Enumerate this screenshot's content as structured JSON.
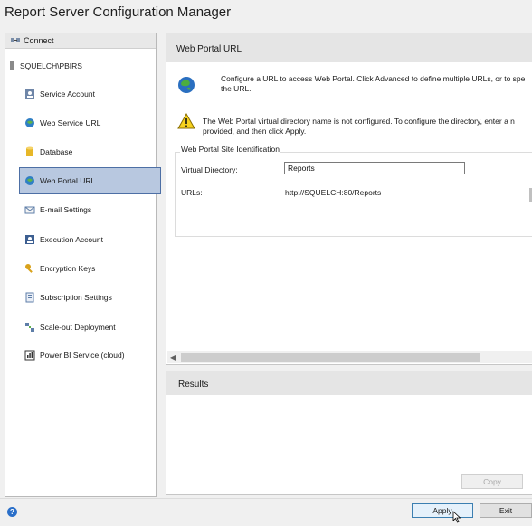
{
  "window": {
    "title": "Report Server Configuration Manager"
  },
  "sidebar": {
    "connect_label": "Connect",
    "server": "SQUELCH\\PBIRS",
    "items": [
      {
        "label": "Service Account",
        "icon": "service-account-icon"
      },
      {
        "label": "Web Service URL",
        "icon": "web-service-url-icon"
      },
      {
        "label": "Database",
        "icon": "database-icon"
      },
      {
        "label": "Web Portal URL",
        "icon": "web-portal-url-icon",
        "selected": true
      },
      {
        "label": "E-mail Settings",
        "icon": "email-settings-icon"
      },
      {
        "label": "Execution Account",
        "icon": "execution-account-icon"
      },
      {
        "label": "Encryption Keys",
        "icon": "encryption-keys-icon"
      },
      {
        "label": "Subscription Settings",
        "icon": "subscription-settings-icon"
      },
      {
        "label": "Scale-out Deployment",
        "icon": "scale-out-deployment-icon"
      },
      {
        "label": "Power BI Service (cloud)",
        "icon": "power-bi-service-icon"
      }
    ]
  },
  "main": {
    "header_title": "Web Portal URL",
    "description": "Configure a URL to access Web Portal.  Click Advanced to define multiple URLs, or to spe the URL.",
    "warning": "The Web Portal virtual directory name is not configured. To configure the directory, enter a n provided, and then click Apply.",
    "group_title": "Web Portal Site Identification",
    "virtual_directory_label": "Virtual Directory:",
    "virtual_directory_value": "Reports",
    "urls_label": "URLs:",
    "urls_value": "http://SQUELCH:80/Reports"
  },
  "results": {
    "header_title": "Results",
    "copy_label": "Copy"
  },
  "footer": {
    "apply_label": "Apply",
    "exit_label": "Exit"
  },
  "colors": {
    "selected_bg": "#b8c8e0",
    "selected_border": "#4d6fa5",
    "panel_header": "#e5e5e5",
    "window_bg": "#f0f0f0"
  }
}
